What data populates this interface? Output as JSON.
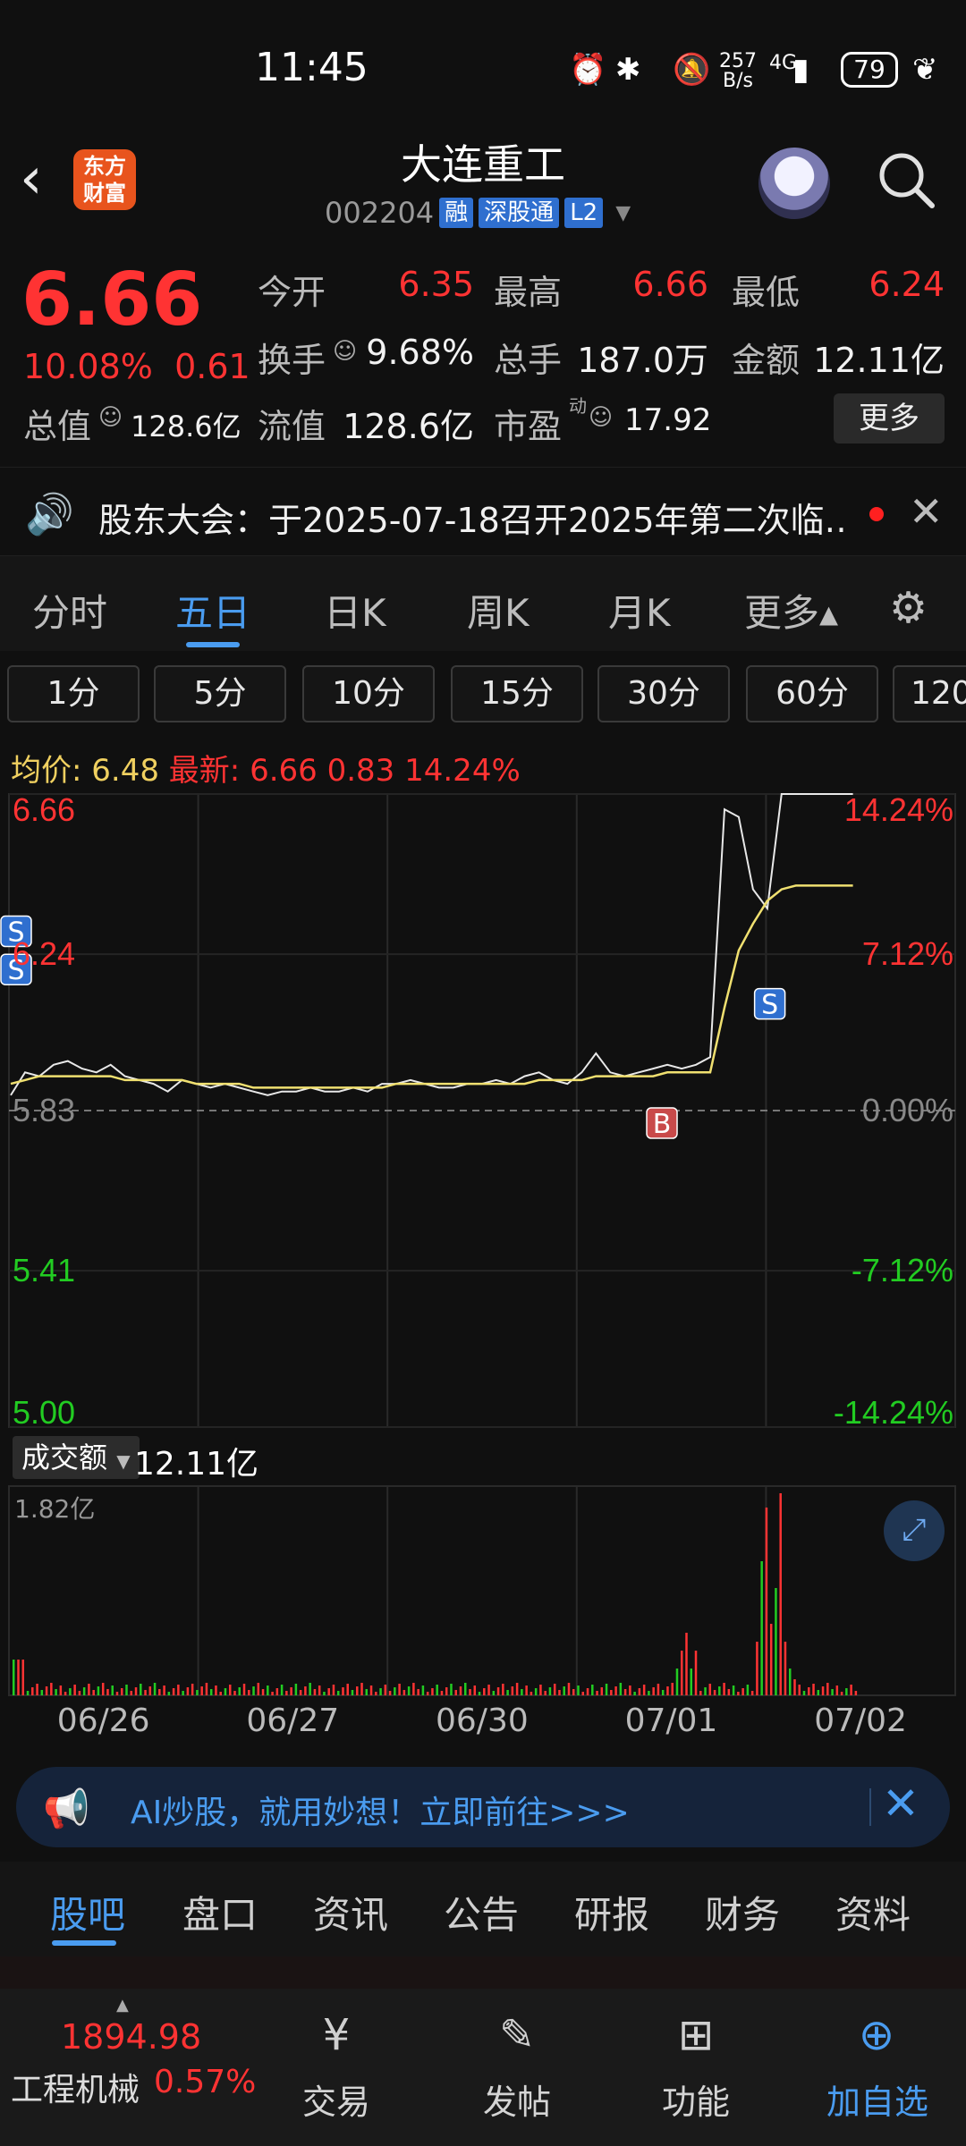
{
  "status_bar": {
    "time": "11:45",
    "net_speed_top": "257",
    "net_speed_unit": "B/s",
    "signal": "4G",
    "battery": "79",
    "icons": [
      "alarm-icon",
      "bluetooth-icon",
      "mute-icon",
      "signal-icon",
      "leaf-icon"
    ]
  },
  "header": {
    "back_icon": "‹",
    "logo_line1": "东方",
    "logo_line2": "财富",
    "title": "大连重工",
    "code": "002204",
    "tags": [
      "融",
      "深股通",
      "L2"
    ]
  },
  "quote": {
    "price": "6.66",
    "change_pct": "10.08%",
    "change_val": "0.61",
    "cells": [
      {
        "label": "今开",
        "value": "6.35",
        "color": "red"
      },
      {
        "label": "最高",
        "value": "6.66",
        "color": "red"
      },
      {
        "label": "最低",
        "value": "6.24",
        "color": "red"
      },
      {
        "label": "换手",
        "value": "9.68%",
        "color": "white"
      },
      {
        "label": "总手",
        "value": "187.0万",
        "color": "white"
      },
      {
        "label": "金额",
        "value": "12.11亿",
        "color": "white"
      },
      {
        "label": "总值",
        "value": "128.6亿",
        "color": "white"
      },
      {
        "label": "流值",
        "value": "128.6亿",
        "color": "white"
      },
      {
        "label": "市盈",
        "value": "17.92",
        "color": "white"
      }
    ],
    "pe_sup": "动",
    "more": "更多"
  },
  "notice": {
    "text": "股东大会：于2025-07-18召开2025年第二次临…",
    "close": "✕"
  },
  "tabs": [
    "分时",
    "五日",
    "日K",
    "周K",
    "月K",
    "更多▴"
  ],
  "active_tab": "五日",
  "periods": [
    "1分",
    "5分",
    "10分",
    "15分",
    "30分",
    "60分",
    "120"
  ],
  "info": {
    "avg_label": "均价:",
    "avg_value": "6.48",
    "latest_label": "最新:",
    "latest_price": "6.66",
    "latest_change": "0.83",
    "latest_pct": "14.24%"
  },
  "chart_data": {
    "type": "line",
    "title": "",
    "y_left_ticks": [
      "6.66",
      "6.24",
      "5.83",
      "5.41",
      "5.00"
    ],
    "y_right_ticks": [
      "14.24%",
      "7.12%",
      "0.00%",
      "-7.12%",
      "-14.24%"
    ],
    "ylim": [
      5.0,
      6.66
    ],
    "base_price": 5.83,
    "x_labels": [
      "06/26",
      "06/27",
      "06/30",
      "07/01",
      "07/02"
    ],
    "series": [
      {
        "name": "",
        "color": "#e8e8e8",
        "values": [
          5.87,
          5.93,
          5.92,
          5.95,
          5.96,
          5.94,
          5.93,
          5.95,
          5.92,
          5.91,
          5.9,
          5.88,
          5.91,
          5.9,
          5.89,
          5.9,
          5.89,
          5.88,
          5.87,
          5.88,
          5.88,
          5.89,
          5.88,
          5.88,
          5.89,
          5.88,
          5.9,
          5.9,
          5.91,
          5.9,
          5.89,
          5.89,
          5.9,
          5.9,
          5.91,
          5.9,
          5.92,
          5.93,
          5.91,
          5.9,
          5.93,
          5.98,
          5.93,
          5.92,
          5.93,
          5.94,
          5.95,
          5.94,
          5.95,
          5.97,
          6.62,
          6.6,
          6.41,
          6.36,
          6.66,
          6.66,
          6.66,
          6.66,
          6.66,
          6.66
        ]
      },
      {
        "name": "",
        "color": "#f0e070",
        "values": [
          5.9,
          5.91,
          5.92,
          5.92,
          5.92,
          5.92,
          5.92,
          5.92,
          5.91,
          5.91,
          5.91,
          5.91,
          5.91,
          5.9,
          5.9,
          5.9,
          5.9,
          5.89,
          5.89,
          5.89,
          5.89,
          5.89,
          5.89,
          5.89,
          5.89,
          5.89,
          5.89,
          5.9,
          5.9,
          5.9,
          5.9,
          5.9,
          5.9,
          5.9,
          5.9,
          5.9,
          5.9,
          5.91,
          5.91,
          5.91,
          5.91,
          5.92,
          5.92,
          5.92,
          5.92,
          5.92,
          5.93,
          5.93,
          5.93,
          5.93,
          6.1,
          6.25,
          6.32,
          6.38,
          6.41,
          6.42,
          6.42,
          6.42,
          6.42,
          6.42
        ]
      }
    ],
    "markers": [
      {
        "label": "S",
        "color": "#2f6fcf"
      },
      {
        "label": "S",
        "color": "#2f6fcf"
      },
      {
        "label": "B",
        "color": "#c94a4a"
      },
      {
        "label": "S",
        "color": "#2f6fcf"
      }
    ],
    "volume": {
      "label": "成交额",
      "total": "12.11亿",
      "max": "1.82亿"
    },
    "grid": true
  },
  "banner": {
    "text": "AI炒股，就用妙想！立即前往>>>",
    "close": "✕"
  },
  "bottom_tabs": [
    "股吧",
    "盘口",
    "资讯",
    "公告",
    "研报",
    "财务",
    "资料"
  ],
  "nav": {
    "index_value": "1894.98",
    "index_name": "工程机械",
    "index_pct": "0.57%",
    "items": [
      "交易",
      "发帖",
      "功能",
      "加自选"
    ]
  }
}
